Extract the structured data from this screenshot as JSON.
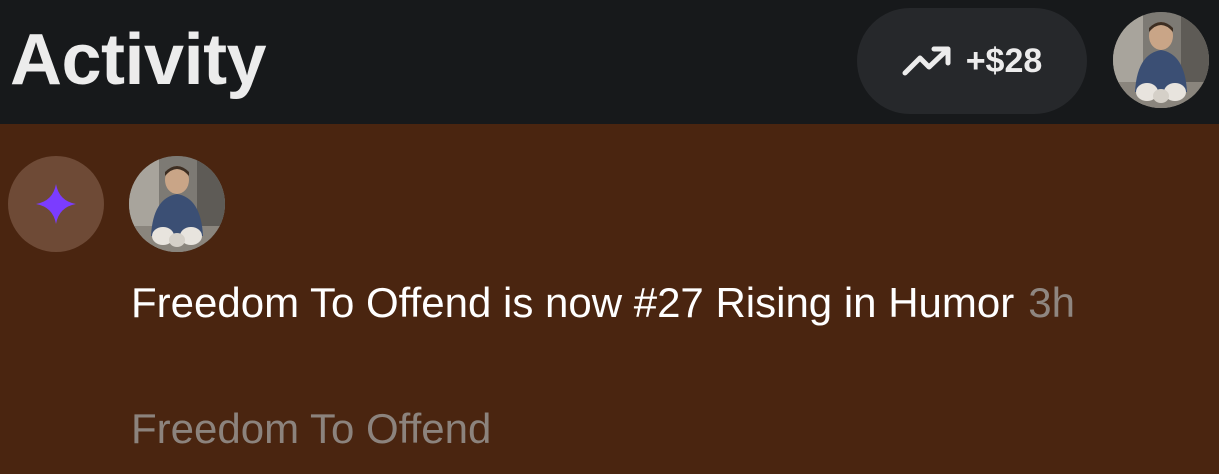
{
  "header": {
    "title": "Activity",
    "earnings": {
      "icon": "trending-up-icon",
      "amount": "+$28"
    },
    "profile_avatar": "user-avatar"
  },
  "activity_items": [
    {
      "badge_icon": "sparkle-icon",
      "badge_color": "#7b3cff",
      "avatar": "user-avatar",
      "message": "Freedom To Offend is now #27 Rising in Humor",
      "time": "3h",
      "source": "Freedom To Offend"
    }
  ],
  "colors": {
    "header_background": "#17191b",
    "item_background": "#4a2510",
    "pill_background": "#26282b"
  }
}
